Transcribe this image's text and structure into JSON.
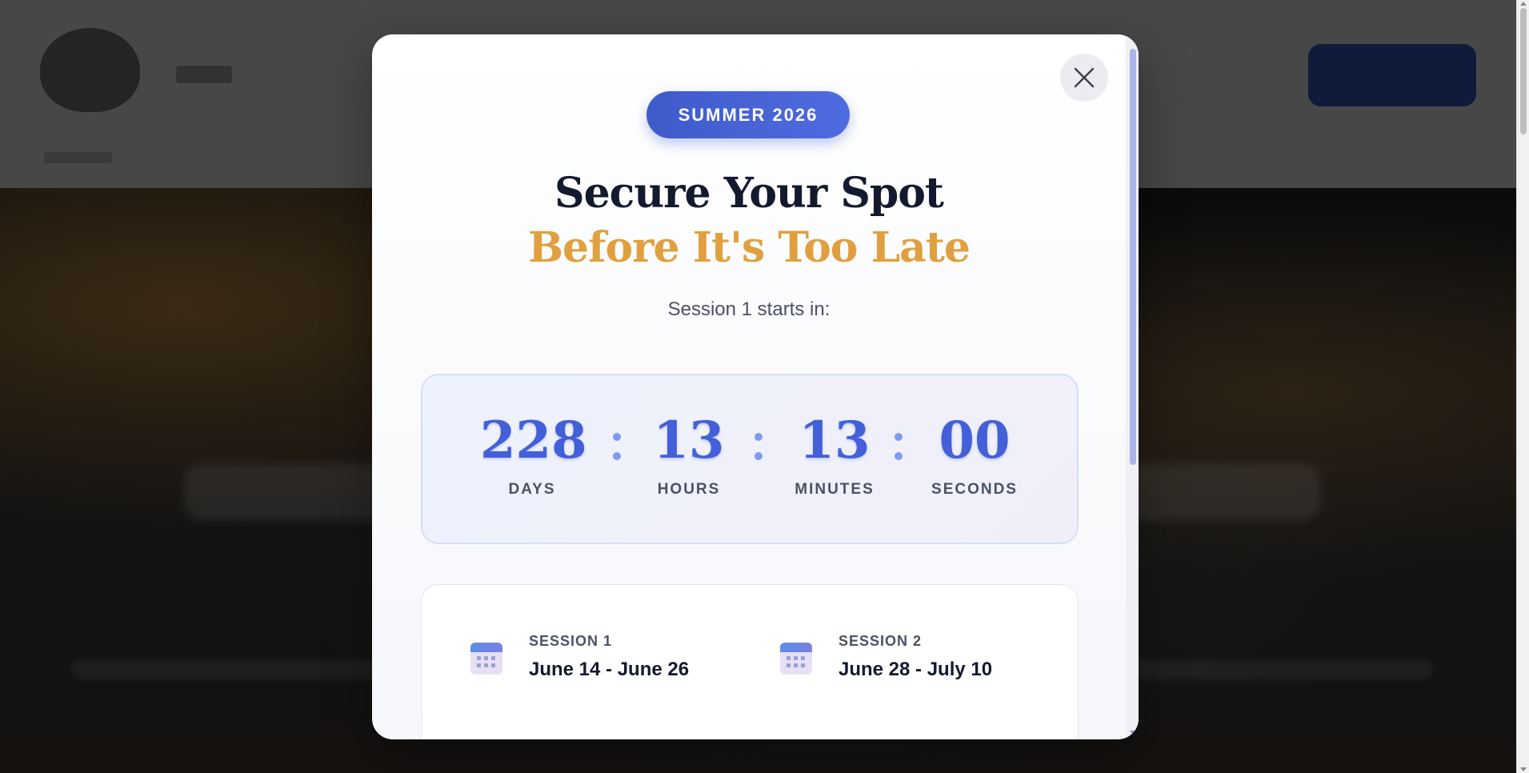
{
  "modal": {
    "badge": "SUMMER 2026",
    "title_line1": "Secure Your Spot",
    "title_line2": "Before It's Too Late",
    "subtitle": "Session 1 starts in:",
    "countdown": {
      "days": {
        "value": "228",
        "label": "DAYS"
      },
      "hours": {
        "value": "13",
        "label": "HOURS"
      },
      "minutes": {
        "value": "13",
        "label": "MINUTES"
      },
      "seconds": {
        "value": "00",
        "label": "SECONDS"
      },
      "separator": ":"
    },
    "sessions": [
      {
        "label": "SESSION 1",
        "dates": "June 14 - June 26",
        "icon": "calendar-icon"
      },
      {
        "label": "SESSION 2",
        "dates": "June 28 - July 10",
        "icon": "calendar-icon"
      }
    ],
    "close_icon": "close-icon"
  },
  "colors": {
    "accent_blue": "#4360d8",
    "accent_gold": "#e0a040",
    "title_dark": "#141a2e"
  }
}
